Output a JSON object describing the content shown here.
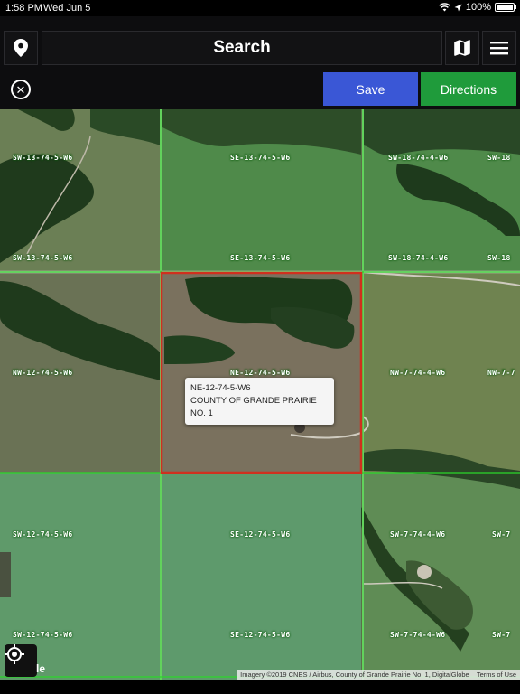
{
  "status": {
    "time": "1:58 PM",
    "date": "Wed Jun 5",
    "battery": "100%",
    "battery_level": 1.0
  },
  "header": {
    "search_label": "Search",
    "save_label": "Save",
    "directions_label": "Directions",
    "colors": {
      "save": "#3a57d6",
      "directions": "#1f9b3b"
    }
  },
  "map": {
    "parcels": [
      "SW-13-74-5-W6",
      "SE-13-74-5-W6",
      "SW-18-74-4-W6",
      "SW-18",
      "SW-13-74-5-W6",
      "SE-13-74-5-W6",
      "SW-18-74-4-W6",
      "SW-18",
      "NW-12-74-5-W6",
      "NE-12-74-5-W6",
      "NW-7-74-4-W6",
      "NW-7-7",
      "SW-12-74-5-W6",
      "SE-12-74-5-W6",
      "SW-7-74-4-W6",
      "SW-7",
      "SW-12-74-5-W6",
      "SE-12-74-5-W6",
      "SW-7-74-4-W6",
      "SW-7"
    ],
    "popup": {
      "line1": "NE-12-74-5-W6",
      "line2": "COUNTY OF GRANDE PRAIRIE NO. 1"
    },
    "google_mark": "le",
    "attribution": "Imagery ©2019 CNES / Airbus, County of Grande Prairie No. 1, DigitalGlobe",
    "terms": "Terms of Use",
    "colors": {
      "grid": "#2bd82b",
      "selected": "#d0301e"
    }
  }
}
